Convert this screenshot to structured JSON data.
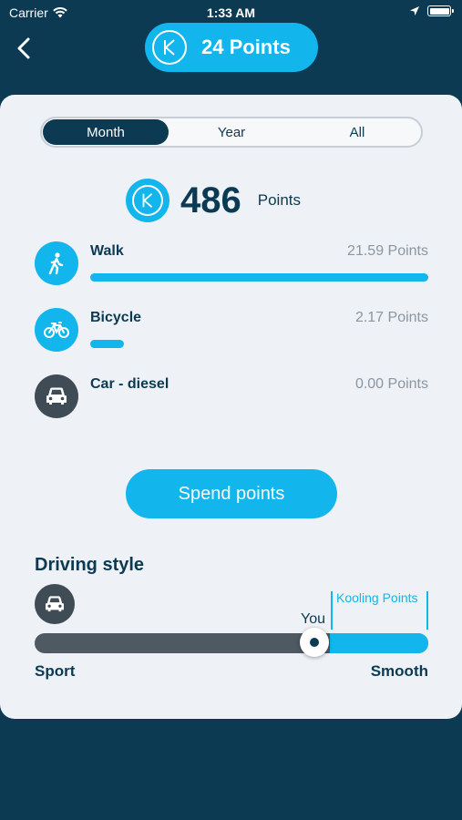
{
  "status_bar": {
    "carrier": "Carrier",
    "time": "1:33 AM"
  },
  "header": {
    "points_label": "24 Points"
  },
  "tabs": [
    {
      "label": "Month",
      "active": true
    },
    {
      "label": "Year",
      "active": false
    },
    {
      "label": "All",
      "active": false
    }
  ],
  "total": {
    "value": "486",
    "unit": "Points"
  },
  "activities": [
    {
      "name": "Walk",
      "points": "21.59 Points",
      "icon": "walk-icon",
      "color": "#12b6ec",
      "fraction": 1.0
    },
    {
      "name": "Bicycle",
      "points": "2.17 Points",
      "icon": "bicycle-icon",
      "color": "#12b6ec",
      "fraction": 0.1
    },
    {
      "name": "Car - diesel",
      "points": "0.00 Points",
      "icon": "car-icon",
      "color": "#3f4b55",
      "fraction": 0.0
    }
  ],
  "spend_button": "Spend points",
  "driving_style": {
    "title": "Driving style",
    "you_label": "You",
    "kooling_label": "Kooling Points",
    "left_label": "Sport",
    "right_label": "Smooth",
    "you_position": 0.71,
    "kooling_start": 0.75
  },
  "colors": {
    "accent": "#12b6ec",
    "navy": "#0b3a52",
    "card": "#eef1f5"
  }
}
